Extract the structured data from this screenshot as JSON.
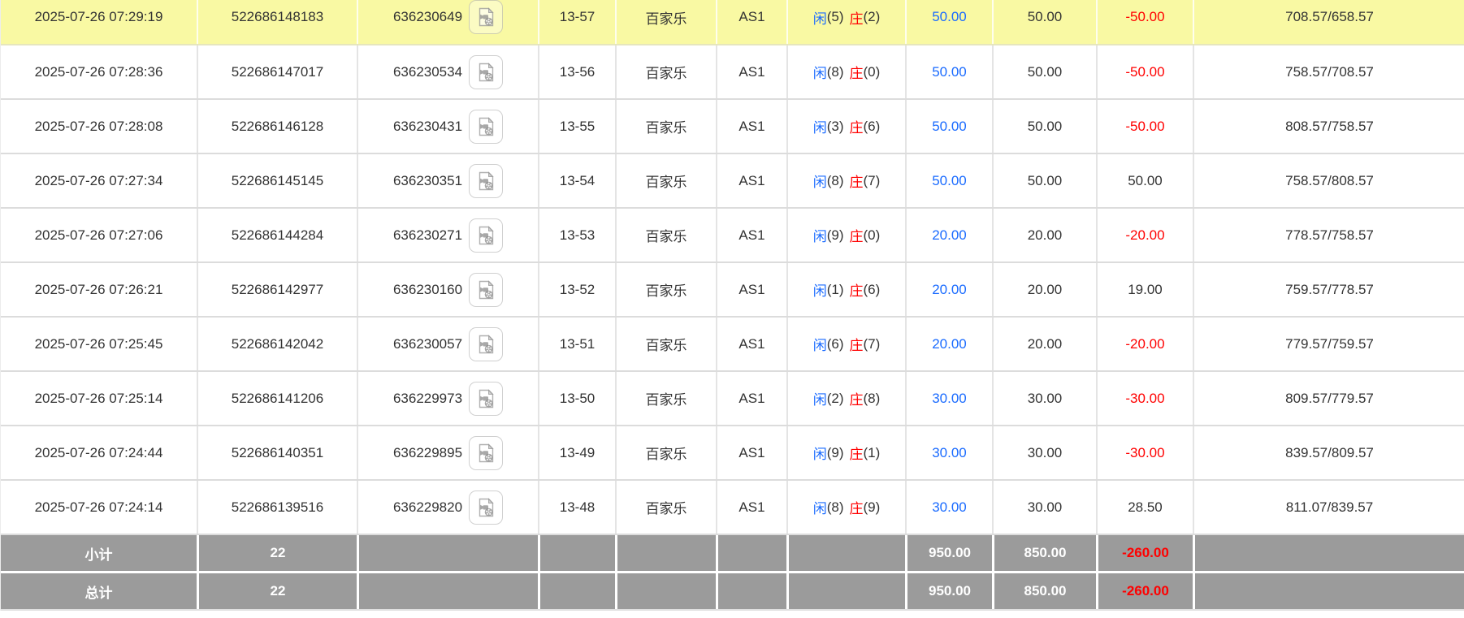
{
  "colors": {
    "highlight_row": "#f9f9a3",
    "accent_blue": "#1a6bff",
    "accent_red": "#ff0000",
    "summary_bg": "#9b9b9b",
    "text": "#333333"
  },
  "icons": {
    "video_button": "video-file-icon"
  },
  "rows": [
    {
      "time": "2025-07-26 07:29:19",
      "bet_id": "522686148183",
      "round_id": "636230649",
      "round_no": "13-57",
      "game": "百家乐",
      "table": "AS1",
      "player_label": "闲",
      "player_points": "(5)",
      "banker_label": "庄",
      "banker_points": "(2)",
      "bet_amount": "50.00",
      "valid_amount": "50.00",
      "win_loss": "-50.00",
      "balance": "708.57/658.57",
      "highlighted": true
    },
    {
      "time": "2025-07-26 07:28:36",
      "bet_id": "522686147017",
      "round_id": "636230534",
      "round_no": "13-56",
      "game": "百家乐",
      "table": "AS1",
      "player_label": "闲",
      "player_points": "(8)",
      "banker_label": "庄",
      "banker_points": "(0)",
      "bet_amount": "50.00",
      "valid_amount": "50.00",
      "win_loss": "-50.00",
      "balance": "758.57/708.57",
      "highlighted": false
    },
    {
      "time": "2025-07-26 07:28:08",
      "bet_id": "522686146128",
      "round_id": "636230431",
      "round_no": "13-55",
      "game": "百家乐",
      "table": "AS1",
      "player_label": "闲",
      "player_points": "(3)",
      "banker_label": "庄",
      "banker_points": "(6)",
      "bet_amount": "50.00",
      "valid_amount": "50.00",
      "win_loss": "-50.00",
      "balance": "808.57/758.57",
      "highlighted": false
    },
    {
      "time": "2025-07-26 07:27:34",
      "bet_id": "522686145145",
      "round_id": "636230351",
      "round_no": "13-54",
      "game": "百家乐",
      "table": "AS1",
      "player_label": "闲",
      "player_points": "(8)",
      "banker_label": "庄",
      "banker_points": "(7)",
      "bet_amount": "50.00",
      "valid_amount": "50.00",
      "win_loss": "50.00",
      "balance": "758.57/808.57",
      "highlighted": false
    },
    {
      "time": "2025-07-26 07:27:06",
      "bet_id": "522686144284",
      "round_id": "636230271",
      "round_no": "13-53",
      "game": "百家乐",
      "table": "AS1",
      "player_label": "闲",
      "player_points": "(9)",
      "banker_label": "庄",
      "banker_points": "(0)",
      "bet_amount": "20.00",
      "valid_amount": "20.00",
      "win_loss": "-20.00",
      "balance": "778.57/758.57",
      "highlighted": false
    },
    {
      "time": "2025-07-26 07:26:21",
      "bet_id": "522686142977",
      "round_id": "636230160",
      "round_no": "13-52",
      "game": "百家乐",
      "table": "AS1",
      "player_label": "闲",
      "player_points": "(1)",
      "banker_label": "庄",
      "banker_points": "(6)",
      "bet_amount": "20.00",
      "valid_amount": "20.00",
      "win_loss": "19.00",
      "balance": "759.57/778.57",
      "highlighted": false
    },
    {
      "time": "2025-07-26 07:25:45",
      "bet_id": "522686142042",
      "round_id": "636230057",
      "round_no": "13-51",
      "game": "百家乐",
      "table": "AS1",
      "player_label": "闲",
      "player_points": "(6)",
      "banker_label": "庄",
      "banker_points": "(7)",
      "bet_amount": "20.00",
      "valid_amount": "20.00",
      "win_loss": "-20.00",
      "balance": "779.57/759.57",
      "highlighted": false
    },
    {
      "time": "2025-07-26 07:25:14",
      "bet_id": "522686141206",
      "round_id": "636229973",
      "round_no": "13-50",
      "game": "百家乐",
      "table": "AS1",
      "player_label": "闲",
      "player_points": "(2)",
      "banker_label": "庄",
      "banker_points": "(8)",
      "bet_amount": "30.00",
      "valid_amount": "30.00",
      "win_loss": "-30.00",
      "balance": "809.57/779.57",
      "highlighted": false
    },
    {
      "time": "2025-07-26 07:24:44",
      "bet_id": "522686140351",
      "round_id": "636229895",
      "round_no": "13-49",
      "game": "百家乐",
      "table": "AS1",
      "player_label": "闲",
      "player_points": "(9)",
      "banker_label": "庄",
      "banker_points": "(1)",
      "bet_amount": "30.00",
      "valid_amount": "30.00",
      "win_loss": "-30.00",
      "balance": "839.57/809.57",
      "highlighted": false
    },
    {
      "time": "2025-07-26 07:24:14",
      "bet_id": "522686139516",
      "round_id": "636229820",
      "round_no": "13-48",
      "game": "百家乐",
      "table": "AS1",
      "player_label": "闲",
      "player_points": "(8)",
      "banker_label": "庄",
      "banker_points": "(9)",
      "bet_amount": "30.00",
      "valid_amount": "30.00",
      "win_loss": "28.50",
      "balance": "811.07/839.57",
      "highlighted": false
    }
  ],
  "summary_rows": [
    {
      "label": "小计",
      "count": "22",
      "bet_total": "950.00",
      "valid_total": "850.00",
      "win_loss_total": "-260.00"
    },
    {
      "label": "总计",
      "count": "22",
      "bet_total": "950.00",
      "valid_total": "850.00",
      "win_loss_total": "-260.00"
    }
  ]
}
